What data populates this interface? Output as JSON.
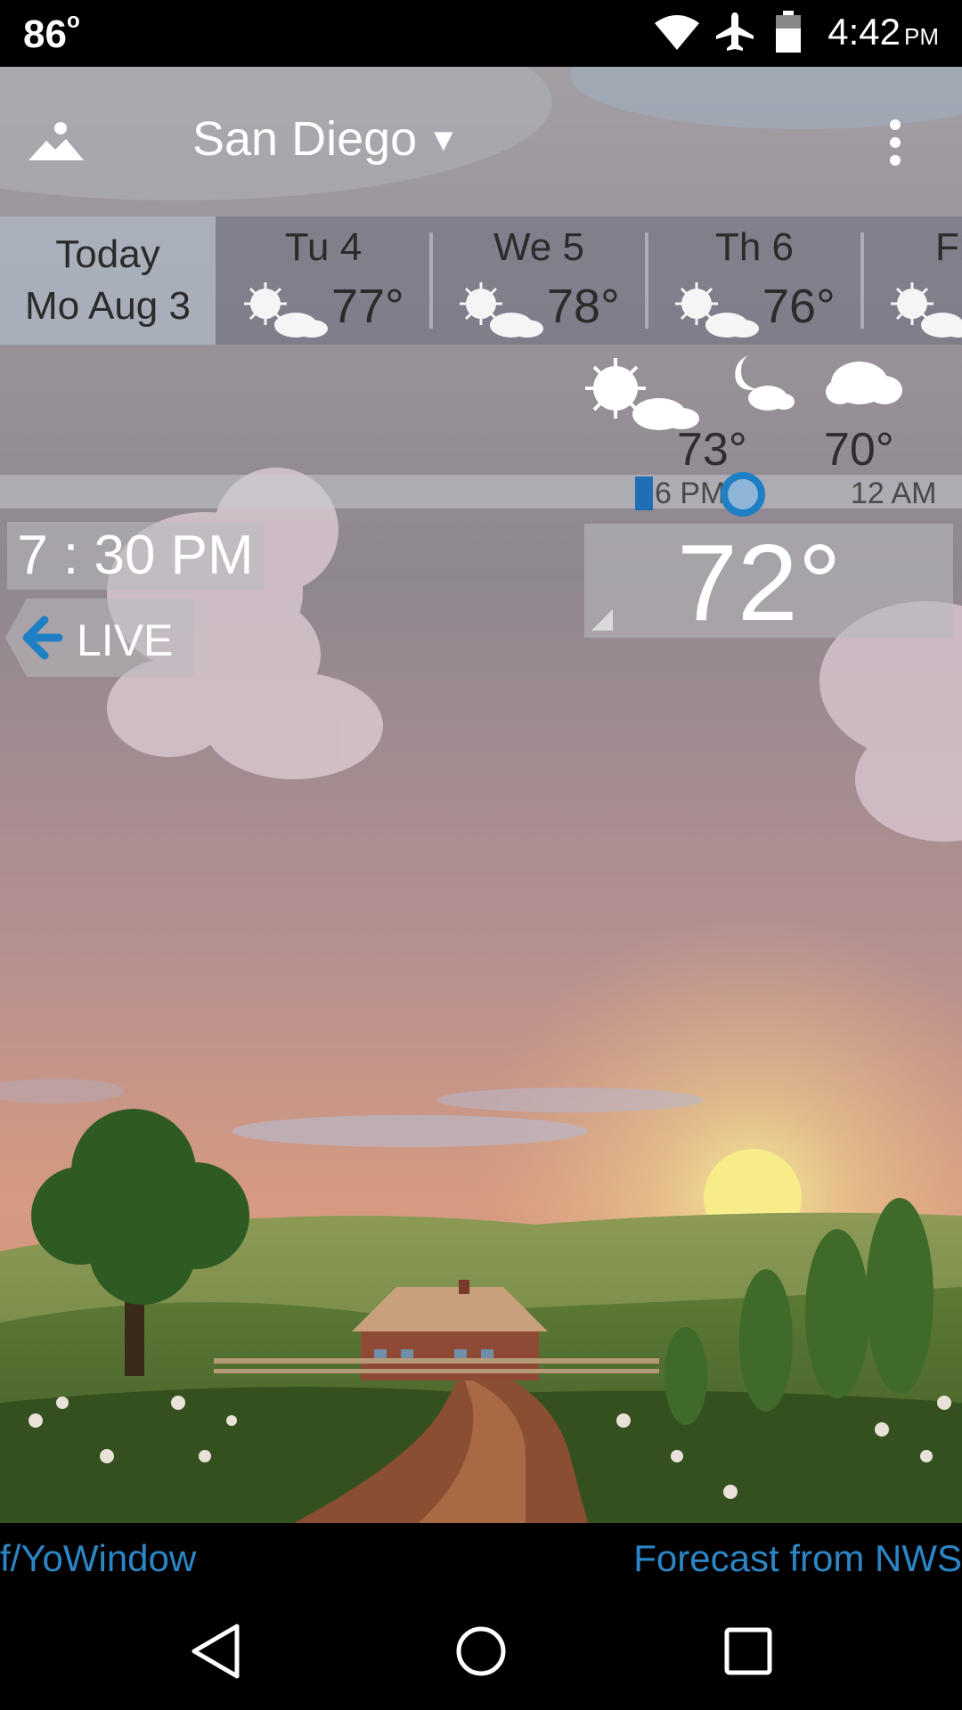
{
  "status_bar": {
    "temperature": "86",
    "time": "4:42",
    "time_suffix": "PM",
    "icons": [
      "wifi-icon",
      "airplane-icon",
      "battery-icon"
    ]
  },
  "header": {
    "city": "San Diego",
    "location_icon": "mountain-icon",
    "menu_icon": "more-vert-icon"
  },
  "days": {
    "today": {
      "line1": "Today",
      "line2": "Mo Aug 3"
    },
    "items": [
      {
        "name": "Tu 4",
        "temp": "77°",
        "icon": "partly-sunny-icon"
      },
      {
        "name": "We 5",
        "temp": "78°",
        "icon": "partly-sunny-icon"
      },
      {
        "name": "Th 6",
        "temp": "76°",
        "icon": "partly-sunny-icon"
      },
      {
        "name": "Fr",
        "temp": "",
        "icon": "partly-sunny-icon"
      }
    ]
  },
  "hourly": {
    "items": [
      {
        "temp": "73°",
        "icon": "partly-sunny-icon"
      },
      {
        "temp": "",
        "icon": "partly-cloudy-night-icon"
      },
      {
        "temp": "70°",
        "icon": "cloud-icon"
      }
    ],
    "timeline_labels": [
      "6 PM",
      "12 AM"
    ]
  },
  "current": {
    "time": "7 : 30 PM",
    "live_label": "LIVE",
    "temperature": "72°"
  },
  "footer": {
    "left": "f/YoWindow",
    "right": "Forecast from NWS"
  },
  "colors": {
    "accent": "#1f7fc4",
    "link": "#2b86c5"
  }
}
